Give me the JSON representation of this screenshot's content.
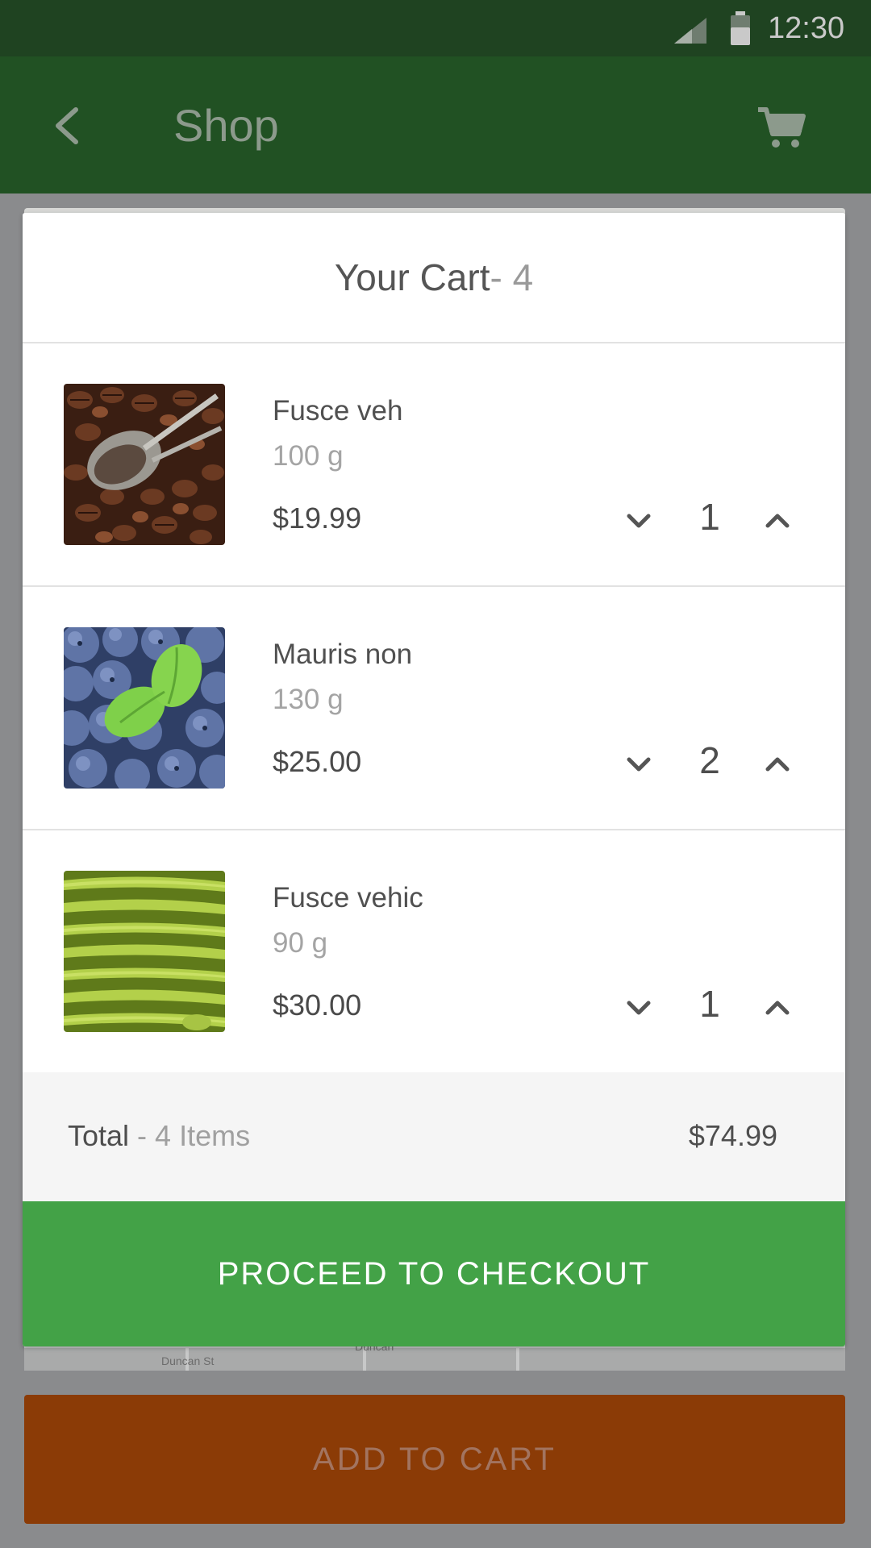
{
  "status_bar": {
    "time": "12:30"
  },
  "app_bar": {
    "title": "Shop"
  },
  "cart": {
    "title": "Your Cart",
    "count_suffix": " - 4",
    "items": [
      {
        "name": "Fusce veh",
        "weight": "100 g",
        "price": "$19.99",
        "quantity": "1",
        "image": "coffee-beans"
      },
      {
        "name": "Mauris non",
        "weight": "130 g",
        "price": "$25.00",
        "quantity": "2",
        "image": "blueberries"
      },
      {
        "name": "Fusce vehic",
        "weight": "90 g",
        "price": "$30.00",
        "quantity": "1",
        "image": "green-beans"
      }
    ],
    "total_label": "Total",
    "total_items": " - 4 Items",
    "total_value": "$74.99",
    "checkout_label": "PROCEED TO CHECKOUT"
  },
  "background": {
    "map_labels": [
      "Duncan St",
      "Duncan"
    ]
  },
  "add_to_cart_label": "ADD TO CART",
  "colors": {
    "status_bar": "#1f4321",
    "app_bar": "#215123",
    "checkout": "#43a247",
    "add_to_cart": "#8b3b06"
  }
}
